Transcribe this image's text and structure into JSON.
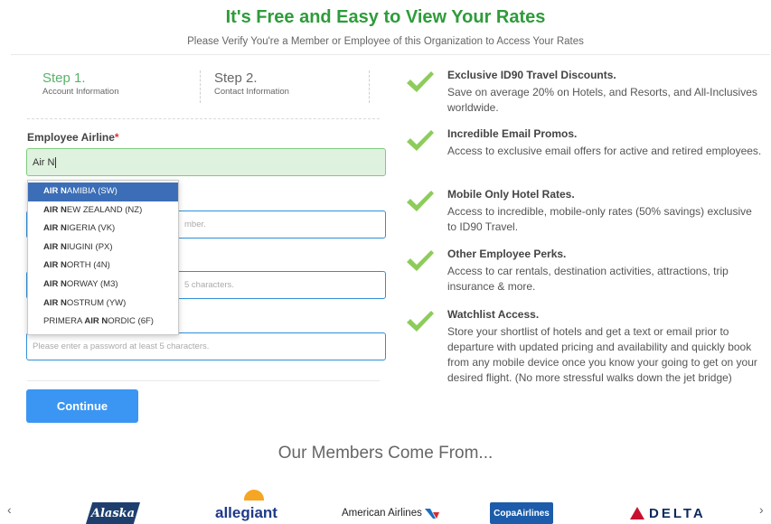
{
  "header": {
    "title": "It's Free and Easy to View Your Rates",
    "subtitle": "Please Verify You're a Member or Employee of this Organization to Access Your Rates"
  },
  "steps": [
    {
      "title": "Step 1.",
      "desc": "Account Information"
    },
    {
      "title": "Step 2.",
      "desc": "Contact Information"
    }
  ],
  "form": {
    "airline_label": "Employee Airline",
    "required_mark": "*",
    "airline_value": "Air N",
    "field2_partial_placeholder": "mber.",
    "field3_partial_placeholder": "5 characters.",
    "password_placeholder": "Please enter a password at least 5 characters.",
    "continue_label": "Continue"
  },
  "dropdown": {
    "selected_index": 0,
    "items": [
      {
        "prefix": "",
        "match": "AIR N",
        "rest": "AMIBIA (SW)"
      },
      {
        "prefix": "",
        "match": "AIR N",
        "rest": "EW ZEALAND (NZ)"
      },
      {
        "prefix": "",
        "match": "AIR N",
        "rest": "IGERIA (VK)"
      },
      {
        "prefix": "",
        "match": "AIR N",
        "rest": "IUGINI (PX)"
      },
      {
        "prefix": "",
        "match": "AIR N",
        "rest": "ORTH (4N)"
      },
      {
        "prefix": "",
        "match": "AIR N",
        "rest": "ORWAY (M3)"
      },
      {
        "prefix": "",
        "match": "AIR N",
        "rest": "OSTRUM (YW)"
      },
      {
        "prefix": "PRIMERA ",
        "match": "AIR N",
        "rest": "ORDIC (6F)"
      }
    ]
  },
  "benefits": [
    {
      "title": "Exclusive ID90 Travel Discounts.",
      "text": "Save on average 20% on Hotels, and Resorts, and All-Inclusives worldwide."
    },
    {
      "title": "Incredible Email Promos.",
      "text": "Access to exclusive email offers for active and retired employees."
    },
    {
      "title": "Mobile Only Hotel Rates.",
      "text": "Access to incredible, mobile-only rates (50% savings) exclusive to ID90 Travel."
    },
    {
      "title": "Other Employee Perks.",
      "text": "Access to car rentals, destination activities, attractions, trip insurance & more."
    },
    {
      "title": "Watchlist Access.",
      "text": "Store your shortlist of hotels and get a text or email prior to departure with updated pricing and availability and quickly book from any mobile device once you know your going to get on your desired flight. (No more stressful walks down the jet bridge)"
    }
  ],
  "members": {
    "heading": "Our Members Come From...",
    "prev_arrow": "‹",
    "next_arrow": "›",
    "logos": [
      "Alaska",
      "allegiant",
      "American Airlines",
      "CopaAirlines",
      "DELTA"
    ]
  },
  "icons": {
    "check": "checkmark-icon"
  },
  "colors": {
    "accent_green": "#2e9c3a",
    "check_green": "#8dcc5a",
    "button_blue": "#3a96f2",
    "dropdown_selected": "#3b6eb6",
    "required_red": "#d9343b"
  }
}
